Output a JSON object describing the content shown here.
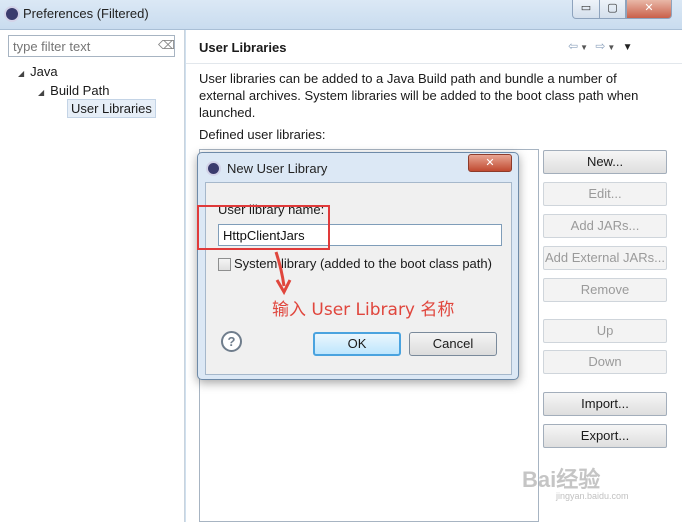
{
  "window": {
    "title": "Preferences (Filtered)",
    "min_label": "▭",
    "max_label": "▢",
    "close_label": "✕"
  },
  "filter": {
    "placeholder": "type filter text",
    "clear_icon": "clear-filter-icon"
  },
  "tree": {
    "java": "Java",
    "build_path": "Build Path",
    "user_libraries": "User Libraries"
  },
  "page": {
    "title": "User Libraries",
    "description": "User libraries can be added to a Java Build path and bundle a number of external archives. System libraries will be added to the boot class path when launched.",
    "defined_label": "Defined user libraries:"
  },
  "buttons": {
    "new": "New...",
    "edit": "Edit...",
    "add_jars": "Add JARs...",
    "add_external_jars": "Add External JARs...",
    "remove": "Remove",
    "up": "Up",
    "down": "Down",
    "import": "Import...",
    "export": "Export..."
  },
  "dialog": {
    "title": "New User Library",
    "name_label": "User library name:",
    "name_value": "HttpClientJars",
    "system_label": "System library (added to the boot class path)",
    "ok": "OK",
    "cancel": "Cancel",
    "close_label": "✕",
    "help": "?"
  },
  "annotation": {
    "text": "输入 User Library 名称",
    "color": "#e0463d"
  },
  "watermark": {
    "text": "Bai经验",
    "url": "jingyan.baidu.com"
  }
}
